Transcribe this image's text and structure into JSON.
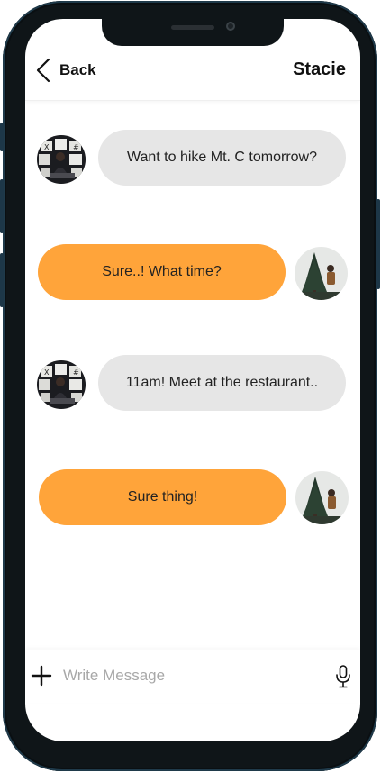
{
  "header": {
    "back_label": "Back",
    "contact_name": "Stacie"
  },
  "messages": [
    {
      "direction": "incoming",
      "text": "Want to hike Mt. C tomorrow?",
      "avatar": "contact-avatar"
    },
    {
      "direction": "outgoing",
      "text": "Sure..! What time?",
      "avatar": "user-avatar"
    },
    {
      "direction": "incoming",
      "text": "11am! Meet at the restaurant..",
      "avatar": "contact-avatar"
    },
    {
      "direction": "outgoing",
      "text": "Sure thing!",
      "avatar": "user-avatar"
    }
  ],
  "composer": {
    "placeholder": "Write Message",
    "value": ""
  },
  "colors": {
    "outgoing_bubble": "#ffa43a",
    "incoming_bubble": "#e6e6e6",
    "device_frame": "#0f1518"
  },
  "icons": {
    "back": "chevron-left-icon",
    "add": "plus-icon",
    "mic": "microphone-icon"
  }
}
